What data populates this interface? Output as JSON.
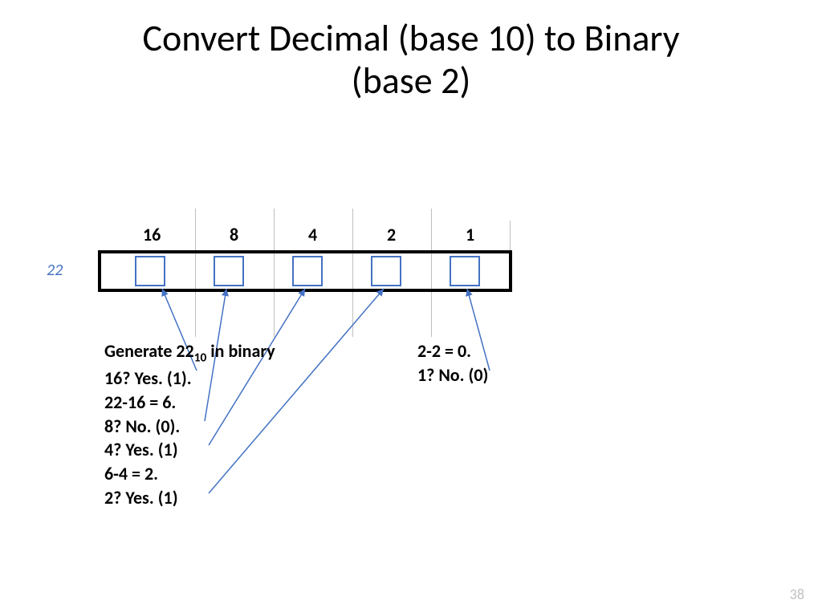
{
  "title_line1": "Convert Decimal (base 10) to Binary",
  "title_line2": "(base 2)",
  "decimal_label": "22",
  "columns": {
    "c16": "16",
    "c8": "8",
    "c4": "4",
    "c2": "2",
    "c1": "1"
  },
  "steps_left": {
    "l1a": "Generate 22",
    "l1b": "10",
    "l1c": " in binary",
    "l2": "16? Yes. (1).",
    "l3": "22-16 = 6.",
    "l4": "8? No. (0).",
    "l5": "4? Yes. (1)",
    "l6": "6-4 = 2.",
    "l7": "2? Yes. (1)"
  },
  "steps_right": {
    "r1": "2-2 = 0.",
    "r2": "1? No. (0)"
  },
  "slide_number": "38"
}
